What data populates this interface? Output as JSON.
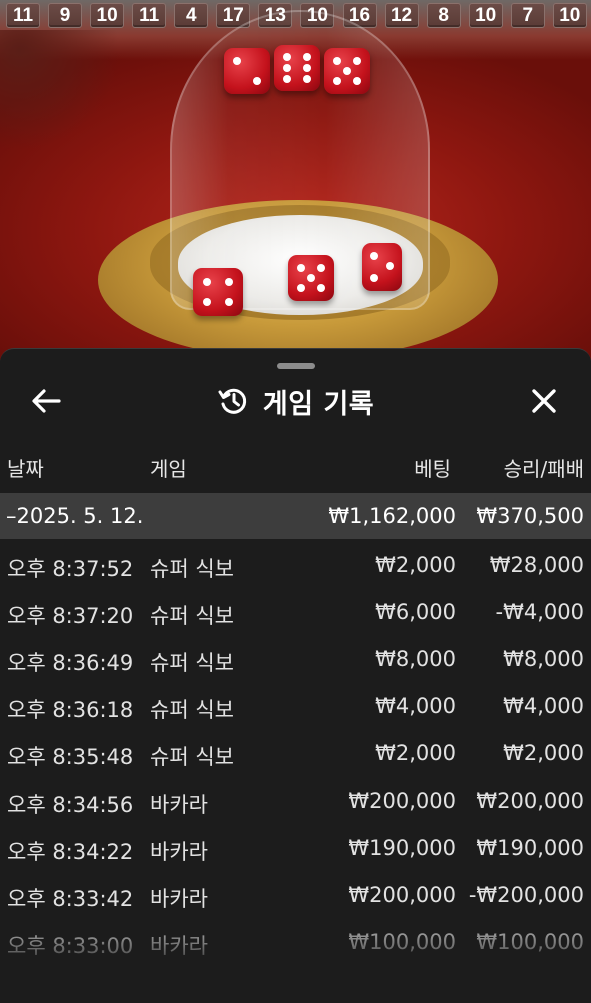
{
  "scene": {
    "road_values": [
      "11",
      "9",
      "10",
      "11",
      "4",
      "17",
      "13",
      "10",
      "16",
      "12",
      "8",
      "10",
      "7",
      "10"
    ],
    "dice_icon": "dice-icon",
    "colors": {
      "felt": "#9a1a12",
      "dice": "#c4121c",
      "gold": "#c89a3a"
    }
  },
  "sheet": {
    "back_icon": "arrow-left-icon",
    "history_icon": "history-icon",
    "close_icon": "close-icon",
    "title": "게임 기록"
  },
  "table": {
    "headers": {
      "date": "날짜",
      "game": "게임",
      "bet": "베팅",
      "result": "승리/패배"
    },
    "date_group": {
      "date": "–2025. 5. 12.",
      "total_bet": "₩1,162,000",
      "total_result": "₩370,500"
    },
    "rows": [
      {
        "time": "오후 8:37:52",
        "game": "슈퍼 식보",
        "bet": "₩2,000",
        "result": "₩28,000"
      },
      {
        "time": "오후 8:37:20",
        "game": "슈퍼 식보",
        "bet": "₩6,000",
        "result": "-₩4,000"
      },
      {
        "time": "오후 8:36:49",
        "game": "슈퍼 식보",
        "bet": "₩8,000",
        "result": "₩8,000"
      },
      {
        "time": "오후 8:36:18",
        "game": "슈퍼 식보",
        "bet": "₩4,000",
        "result": "₩4,000"
      },
      {
        "time": "오후 8:35:48",
        "game": "슈퍼 식보",
        "bet": "₩2,000",
        "result": "₩2,000"
      },
      {
        "time": "오후 8:34:56",
        "game": "바카라",
        "bet": "₩200,000",
        "result": "₩200,000"
      },
      {
        "time": "오후 8:34:22",
        "game": "바카라",
        "bet": "₩190,000",
        "result": "₩190,000"
      },
      {
        "time": "오후 8:33:42",
        "game": "바카라",
        "bet": "₩200,000",
        "result": "-₩200,000"
      },
      {
        "time": "오후 8:33:00",
        "game": "바카라",
        "bet": "₩100,000",
        "result": "₩100,000"
      }
    ]
  }
}
